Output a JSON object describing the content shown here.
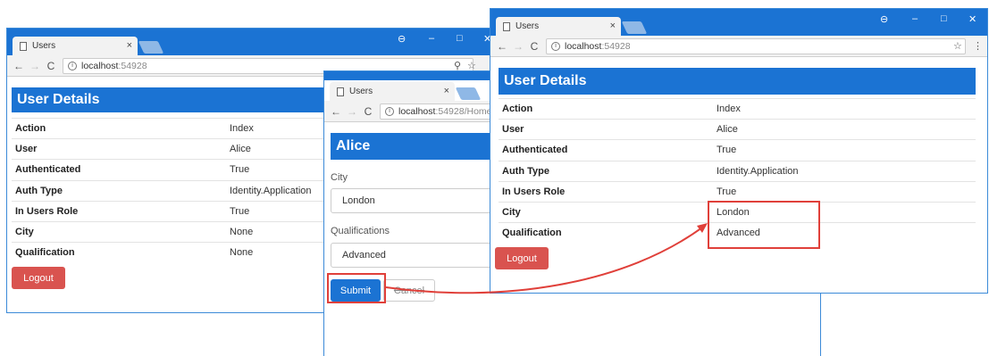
{
  "window1": {
    "tab_title": "Users",
    "tab_close": "×",
    "url_host": "localhost",
    "url_port": ":54928",
    "controls": [
      "⊖",
      "–",
      "□",
      "✕"
    ],
    "heading": "User Details",
    "rows": [
      {
        "key": "Action",
        "value": "Index"
      },
      {
        "key": "User",
        "value": "Alice"
      },
      {
        "key": "Authenticated",
        "value": "True"
      },
      {
        "key": "Auth Type",
        "value": "Identity.Application"
      },
      {
        "key": "In Users Role",
        "value": "True"
      },
      {
        "key": "City",
        "value": "None"
      },
      {
        "key": "Qualification",
        "value": "None"
      }
    ],
    "logout_label": "Logout"
  },
  "window2": {
    "tab_title": "Users",
    "tab_close": "×",
    "url_host": "localhost",
    "url_port": ":54928/Home/",
    "heading": "Alice",
    "city_label": "City",
    "city_value": "London",
    "qualifications_label": "Qualifications",
    "qualifications_value": "Advanced",
    "submit_label": "Submit",
    "cancel_label": "Cancel"
  },
  "window3": {
    "tab_title": "Users",
    "tab_close": "×",
    "url_host": "localhost",
    "url_port": ":54928",
    "controls": [
      "⊖",
      "–",
      "□",
      "✕"
    ],
    "heading": "User Details",
    "rows": [
      {
        "key": "Action",
        "value": "Index"
      },
      {
        "key": "User",
        "value": "Alice"
      },
      {
        "key": "Authenticated",
        "value": "True"
      },
      {
        "key": "Auth Type",
        "value": "Identity.Application"
      },
      {
        "key": "In Users Role",
        "value": "True"
      },
      {
        "key": "City",
        "value": "London"
      },
      {
        "key": "Qualification",
        "value": "Advanced"
      }
    ],
    "logout_label": "Logout"
  },
  "icons": {
    "back": "←",
    "forward": "→",
    "reload": "C",
    "info": "i",
    "key": "⚲",
    "star": "☆",
    "menu": "⋮"
  },
  "colors": {
    "chrome_blue": "#1b73d3",
    "logout_red": "#d9534f",
    "highlight_red": "#e0403a"
  }
}
